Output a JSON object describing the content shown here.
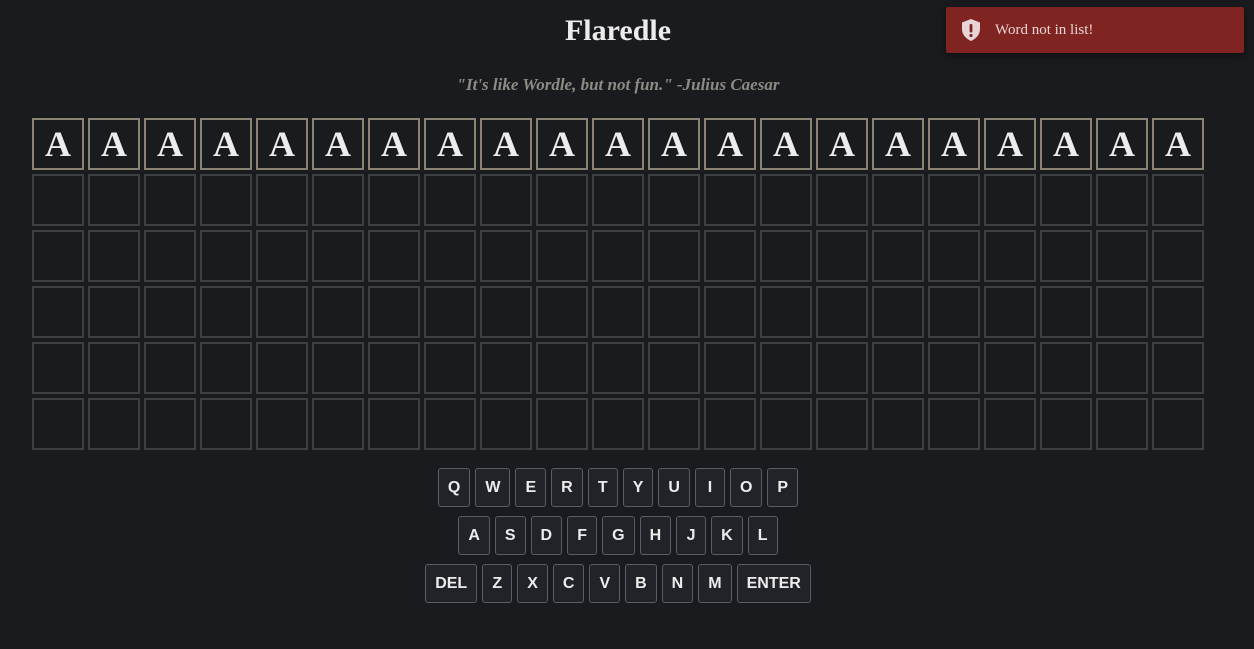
{
  "app": {
    "title": "Flaredle",
    "subtitle": "\"It's like Wordle, but not fun.\" -Julius Caesar"
  },
  "board": {
    "rows": 6,
    "cols": 21,
    "guesses": [
      [
        "A",
        "A",
        "A",
        "A",
        "A",
        "A",
        "A",
        "A",
        "A",
        "A",
        "A",
        "A",
        "A",
        "A",
        "A",
        "A",
        "A",
        "A",
        "A",
        "A",
        "A"
      ]
    ]
  },
  "keyboard": {
    "rows": [
      [
        "Q",
        "W",
        "E",
        "R",
        "T",
        "Y",
        "U",
        "I",
        "O",
        "P"
      ],
      [
        "A",
        "S",
        "D",
        "F",
        "G",
        "H",
        "J",
        "K",
        "L"
      ],
      [
        "DEL",
        "Z",
        "X",
        "C",
        "V",
        "B",
        "N",
        "M",
        "ENTER"
      ]
    ]
  },
  "toast": {
    "message": "Word not in list!",
    "icon": "shield-exclamation-icon",
    "color": "#7f2421"
  },
  "colors": {
    "background": "#191b1e",
    "tile_border_empty": "#3c4043",
    "tile_border_filled": "#8b8373",
    "key_background": "#222328"
  }
}
